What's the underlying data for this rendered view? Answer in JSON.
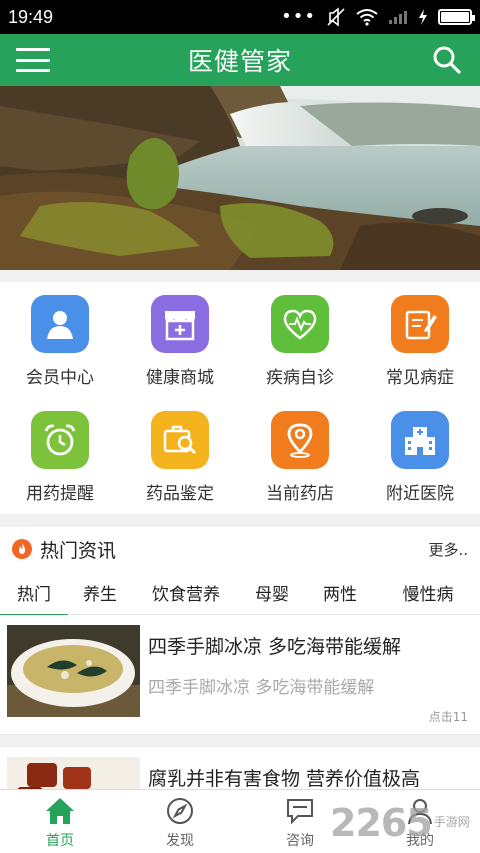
{
  "status_bar": {
    "time": "19:49",
    "battery_level": 1.0
  },
  "header": {
    "title": "医健管家"
  },
  "grid": [
    {
      "label": "会员中心",
      "icon": "user-icon",
      "color": "#4a8fe8"
    },
    {
      "label": "健康商城",
      "icon": "shop-icon",
      "color": "#8a6de0"
    },
    {
      "label": "疾病自诊",
      "icon": "heart-pulse-icon",
      "color": "#5fbf3a"
    },
    {
      "label": "常见病症",
      "icon": "notepad-icon",
      "color": "#f07c1e"
    },
    {
      "label": "用药提醒",
      "icon": "alarm-clock-icon",
      "color": "#7cc23a"
    },
    {
      "label": "药品鉴定",
      "icon": "medicine-search-icon",
      "color": "#f4b21d"
    },
    {
      "label": "当前药店",
      "icon": "location-pin-icon",
      "color": "#f07c1e"
    },
    {
      "label": "附近医院",
      "icon": "hospital-icon",
      "color": "#4a8fe8"
    }
  ],
  "news": {
    "title": "热门资讯",
    "more": "更多..",
    "tabs": [
      "热门",
      "养生",
      "饮食营养",
      "母婴",
      "两性",
      "慢性病"
    ],
    "articles": [
      {
        "title": "四季手脚冰凉 多吃海带能缓解",
        "subtitle": "四季手脚冰凉 多吃海带能缓解",
        "clicks": "点击11"
      },
      {
        "title": "腐乳并非有害食物 营养价值极高"
      }
    ]
  },
  "bottom_nav": [
    {
      "label": "首页",
      "icon": "home-icon"
    },
    {
      "label": "发现",
      "icon": "compass-icon"
    },
    {
      "label": "咨询",
      "icon": "chat-icon"
    },
    {
      "label": "我的",
      "icon": "profile-icon"
    }
  ],
  "watermark": {
    "number": "2265",
    "text": "手游网"
  },
  "colors": {
    "primary": "#27a25a",
    "status_bar": "#000000",
    "accent": "#f26522"
  }
}
